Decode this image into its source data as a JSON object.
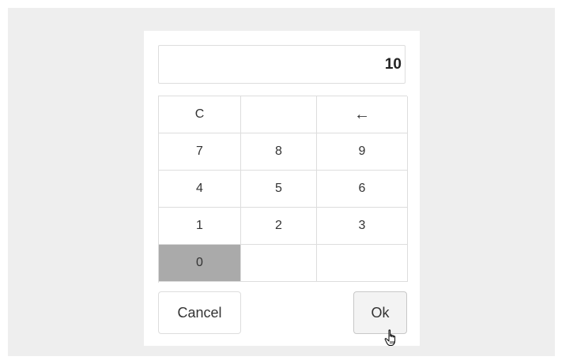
{
  "display": {
    "value": "10"
  },
  "keypad": {
    "clear_label": "C",
    "backspace_label": "←",
    "keys": [
      "7",
      "8",
      "9",
      "4",
      "5",
      "6",
      "1",
      "2",
      "3",
      "0"
    ],
    "pressed_key": "0"
  },
  "buttons": {
    "cancel_label": "Cancel",
    "ok_label": "Ok"
  },
  "colors": {
    "backdrop": "#eeeeee",
    "pressed_key": "#aaaaaa",
    "border": "#dddddd"
  },
  "icons": {
    "backspace": "arrow-left-icon",
    "cursor": "hand-pointer-icon"
  }
}
